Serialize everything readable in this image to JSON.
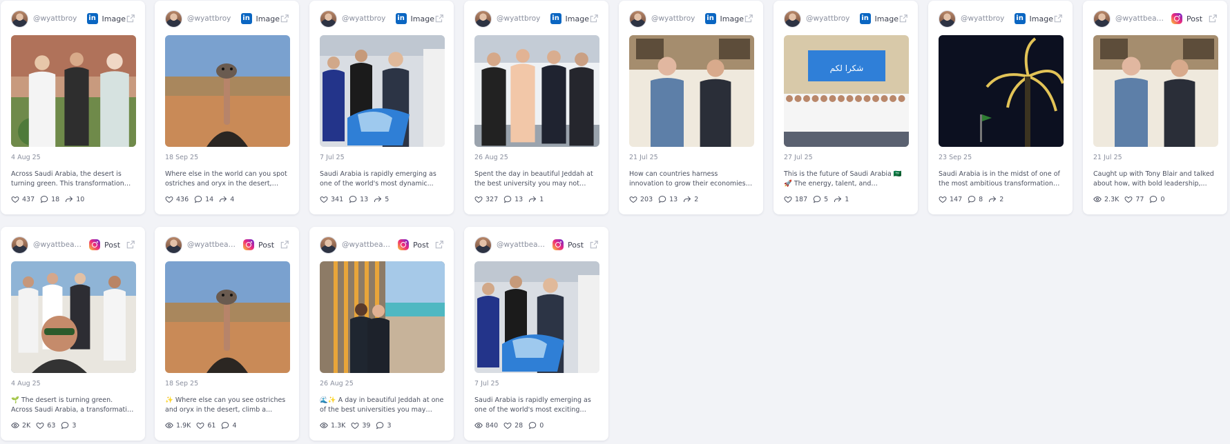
{
  "cards": [
    {
      "handle": "@wyattbroy",
      "platform": "linkedin",
      "platform_icon": "linkedin-icon",
      "type": "Image",
      "date": "4 Aug 25",
      "caption": "Across Saudi Arabia, the desert is turning green. This transformation is...",
      "stats": [
        {
          "icon": "heart",
          "value": "437"
        },
        {
          "icon": "comment",
          "value": "18"
        },
        {
          "icon": "share",
          "value": "10"
        }
      ],
      "photo": "garden"
    },
    {
      "handle": "@wyattbroy",
      "platform": "linkedin",
      "platform_icon": "linkedin-icon",
      "type": "Image",
      "date": "18 Sep 25",
      "caption": "Where else in the world can you spot ostriches and oryx in the desert, climb...",
      "stats": [
        {
          "icon": "heart",
          "value": "436"
        },
        {
          "icon": "comment",
          "value": "14"
        },
        {
          "icon": "share",
          "value": "4"
        }
      ],
      "photo": "ostrich"
    },
    {
      "handle": "@wyattbroy",
      "platform": "linkedin",
      "platform_icon": "linkedin-icon",
      "type": "Image",
      "date": "7 Jul 25",
      "caption": "Saudi Arabia is rapidly emerging as one of the world's most dynamic...",
      "stats": [
        {
          "icon": "heart",
          "value": "341"
        },
        {
          "icon": "comment",
          "value": "13"
        },
        {
          "icon": "share",
          "value": "5"
        }
      ],
      "photo": "fashion"
    },
    {
      "handle": "@wyattbroy",
      "platform": "linkedin",
      "platform_icon": "linkedin-icon",
      "type": "Image",
      "date": "26 Aug 25",
      "caption": "Spent the day in beautiful Jeddah at the best university you may not have...",
      "stats": [
        {
          "icon": "heart",
          "value": "327"
        },
        {
          "icon": "comment",
          "value": "13"
        },
        {
          "icon": "share",
          "value": "1"
        }
      ],
      "photo": "group4"
    },
    {
      "handle": "@wyattbroy",
      "platform": "linkedin",
      "platform_icon": "linkedin-icon",
      "type": "Image",
      "date": "21 Jul 25",
      "caption": "How can countries harness innovation to grow their economies and improve...",
      "stats": [
        {
          "icon": "heart",
          "value": "203"
        },
        {
          "icon": "comment",
          "value": "13"
        },
        {
          "icon": "share",
          "value": "2"
        }
      ],
      "photo": "duo"
    },
    {
      "handle": "@wyattbroy",
      "platform": "linkedin",
      "platform_icon": "linkedin-icon",
      "type": "Image",
      "date": "27 Jul 25",
      "caption": "This is the future of Saudi Arabia 🇸🇦🚀 The energy, talent, and enthusiasm of...",
      "stats": [
        {
          "icon": "heart",
          "value": "187"
        },
        {
          "icon": "comment",
          "value": "5"
        },
        {
          "icon": "share",
          "value": "1"
        }
      ],
      "photo": "stage"
    },
    {
      "handle": "@wyattbroy",
      "platform": "linkedin",
      "platform_icon": "linkedin-icon",
      "type": "Image",
      "date": "23 Sep 25",
      "caption": "Saudi Arabia is in the midst of one of the most ambitious transformations i...",
      "stats": [
        {
          "icon": "heart",
          "value": "147"
        },
        {
          "icon": "comment",
          "value": "8"
        },
        {
          "icon": "share",
          "value": "2"
        }
      ],
      "photo": "palm"
    },
    {
      "handle": "@wyattbeauregard",
      "platform": "instagram",
      "platform_icon": "instagram-icon",
      "type": "Post",
      "date": "21 Jul 25",
      "caption": "Caught up with Tony Blair and talked about how, with bold leadership,...",
      "stats": [
        {
          "icon": "eye",
          "value": "2.3K"
        },
        {
          "icon": "heart",
          "value": "77"
        },
        {
          "icon": "comment",
          "value": "0"
        }
      ],
      "photo": "duo"
    },
    {
      "handle": "@wyattbeauregard",
      "platform": "instagram",
      "platform_icon": "instagram-icon",
      "type": "Post",
      "date": "4 Aug 25",
      "caption": "🌱 The desert is turning green. Across Saudi Arabia, a transformation is...",
      "stats": [
        {
          "icon": "eye",
          "value": "2K"
        },
        {
          "icon": "heart",
          "value": "63"
        },
        {
          "icon": "comment",
          "value": "3"
        }
      ],
      "photo": "selfie"
    },
    {
      "handle": "@wyattbeauregard",
      "platform": "instagram",
      "platform_icon": "instagram-icon",
      "type": "Post",
      "date": "18 Sep 25",
      "caption": "✨ Where else can you see ostriches and oryx in the desert, climb a...",
      "stats": [
        {
          "icon": "eye",
          "value": "1.9K"
        },
        {
          "icon": "heart",
          "value": "61"
        },
        {
          "icon": "comment",
          "value": "4"
        }
      ],
      "photo": "ostrich"
    },
    {
      "handle": "@wyattbeauregard",
      "platform": "instagram",
      "platform_icon": "instagram-icon",
      "type": "Post",
      "date": "26 Aug 25",
      "caption": "🌊✨ A day in beautiful Jeddah at one of the best universities you may not...",
      "stats": [
        {
          "icon": "eye",
          "value": "1.3K"
        },
        {
          "icon": "heart",
          "value": "39"
        },
        {
          "icon": "comment",
          "value": "3"
        }
      ],
      "photo": "balcony"
    },
    {
      "handle": "@wyattbeauregard",
      "platform": "instagram",
      "platform_icon": "instagram-icon",
      "type": "Post",
      "date": "7 Jul 25",
      "caption": "Saudi Arabia is rapidly emerging as one of the world's most exciting place...",
      "stats": [
        {
          "icon": "eye",
          "value": "840"
        },
        {
          "icon": "heart",
          "value": "28"
        },
        {
          "icon": "comment",
          "value": "0"
        }
      ],
      "photo": "fashion"
    }
  ],
  "colors": {
    "linkedin": "#0a66c2",
    "background": "#f2f3f7",
    "card": "#ffffff",
    "muted_text": "#8a8f9e"
  }
}
